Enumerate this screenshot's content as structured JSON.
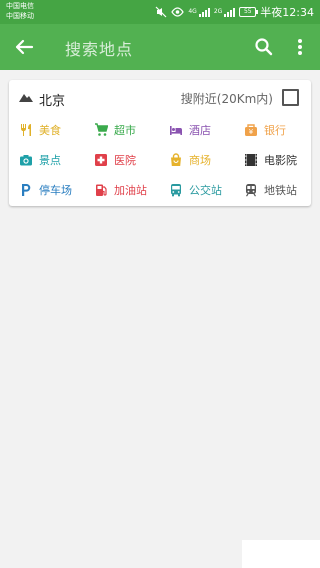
{
  "status_bar": {
    "carrier1": "中国电信",
    "carrier2": "中国移动",
    "network1": "4G",
    "network2": "2G",
    "battery": "55",
    "time": "半夜12:34"
  },
  "app_bar": {
    "title": "搜索地点"
  },
  "location": {
    "city": "北京",
    "nearby_label": "搜附近(20Km内)",
    "nearby_checked": false
  },
  "categories": [
    {
      "label": "美食",
      "icon": "fork-knife-icon",
      "color": "#e0b12a"
    },
    {
      "label": "超市",
      "icon": "shopping-cart-icon",
      "color": "#3aaa4c"
    },
    {
      "label": "酒店",
      "icon": "bed-icon",
      "color": "#8a53b0"
    },
    {
      "label": "银行",
      "icon": "bank-icon",
      "color": "#f0a24a"
    },
    {
      "label": "景点",
      "icon": "camera-icon",
      "color": "#1ea0a8"
    },
    {
      "label": "医院",
      "icon": "medical-cross-icon",
      "color": "#e0404a"
    },
    {
      "label": "商场",
      "icon": "shopping-bag-icon",
      "color": "#e6b22c"
    },
    {
      "label": "电影院",
      "icon": "film-icon",
      "color": "#333333"
    },
    {
      "label": "停车场",
      "icon": "parking-icon",
      "color": "#2a7ec0"
    },
    {
      "label": "加油站",
      "icon": "fuel-pump-icon",
      "color": "#e0404a"
    },
    {
      "label": "公交站",
      "icon": "bus-icon",
      "color": "#2a9aa0"
    },
    {
      "label": "地铁站",
      "icon": "subway-icon",
      "color": "#555555"
    }
  ]
}
